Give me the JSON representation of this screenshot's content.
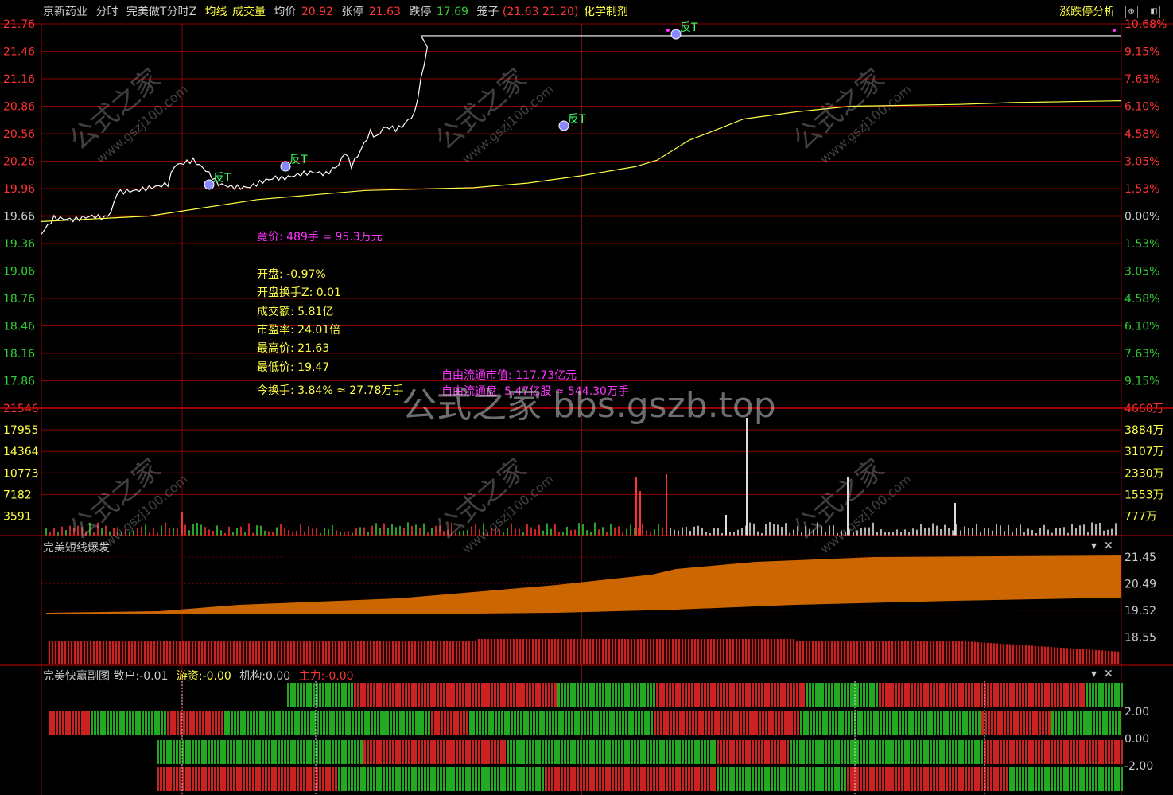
{
  "header": {
    "stock_name": "京新药业",
    "mode": "分时",
    "indicator": "完美做T分时Z",
    "avg_line_label": "均线",
    "volume_label": "成交量",
    "avg_price_label": "均价",
    "avg_price_value": "20.92",
    "limit_up_label": "张停",
    "limit_up_value": "21.63",
    "limit_down_label": "跌停",
    "limit_down_value": "17.69",
    "cage_label": "笼子",
    "cage_value": "(21.63 21.20)",
    "sector": "化学制剂",
    "analysis_link": "涨跌停分析",
    "colors": {
      "up": "#ff3333",
      "down": "#33cc33",
      "yellow": "#ffff44",
      "magenta": "#ff33ff",
      "orange": "#cc6600",
      "grid": "#aa0000"
    }
  },
  "price_axis": {
    "left_ticks": [
      "21.76",
      "21.46",
      "21.16",
      "20.86",
      "20.56",
      "20.26",
      "19.96",
      "19.66",
      "19.36",
      "19.06",
      "18.76",
      "18.46",
      "18.16",
      "17.86"
    ],
    "right_ticks": [
      "10.68%",
      "9.15%",
      "7.63%",
      "6.10%",
      "4.58%",
      "3.05%",
      "1.53%",
      "0.00%",
      "1.53%",
      "3.05%",
      "4.58%",
      "6.10%",
      "7.63%",
      "9.15%"
    ]
  },
  "volume_axis": {
    "left_ticks": [
      "21546",
      "17955",
      "14364",
      "10773",
      "7182",
      "3591"
    ],
    "right_ticks": [
      "4660万",
      "3884万",
      "3107万",
      "2330万",
      "1553万",
      "777万"
    ]
  },
  "sub1": {
    "title": "完美短线爆发",
    "right_ticks": [
      "21.45",
      "20.49",
      "19.52",
      "18.55"
    ]
  },
  "sub2": {
    "title": "完美快赢副图",
    "retail_label": "散户:",
    "retail_value": "-0.01",
    "hot_label": "游资:",
    "hot_value": "-0.00",
    "inst_label": "机构:",
    "inst_value": "0.00",
    "main_label": "主力:",
    "main_value": "-0.00",
    "right_ticks": [
      "2.00",
      "0.00",
      "-2.00"
    ]
  },
  "signals": [
    "反T",
    "反T",
    "反T",
    "反T"
  ],
  "info": {
    "auction": "竟价: 489手 = 95.3万元",
    "open_pct": "开盘: -0.97%",
    "open_turnover": "开盘换手Z: 0.01",
    "amount": "成交额: 5.81亿",
    "pe": "市盈率: 24.01倍",
    "high": "最高价: 21.63",
    "low": "最低价: 19.47",
    "turnover": "今换手: 3.84% ≈ 27.78万手",
    "free_cap": "自由流通市值: 117.73亿元",
    "free_float": "自由流通盘: 5.47亿股 ≈ 544.30万手"
  },
  "watermark": {
    "main": "公式之家 bbs.gszb.top",
    "diag": "公式之家",
    "diag_url": "www.gszj100.com"
  },
  "chart_data": [
    {
      "type": "line",
      "title": "",
      "ylim": [
        17.69,
        21.76
      ],
      "series": [
        {
          "name": "价格",
          "color": "#ffffff",
          "x_fraction": [
            0,
            0.02,
            0.05,
            0.08,
            0.1,
            0.11,
            0.12,
            0.15,
            0.18,
            0.2,
            0.21,
            0.24,
            0.26,
            0.28,
            0.3,
            0.32,
            0.33,
            0.35,
            0.37,
            0.38,
            0.4,
            0.41,
            0.43,
            0.45,
            0.47,
            0.48,
            0.49,
            0.5,
            0.51,
            0.52,
            0.53,
            0.54,
            0.55,
            0.56,
            0.57,
            0.58,
            0.59,
            0.6,
            0.61,
            0.6
          ],
          "values": [
            19.47,
            19.64,
            19.62,
            19.66,
            19.64,
            19.7,
            19.92,
            19.94,
            19.98,
            20.01,
            20.21,
            20.27,
            20.16,
            20.01,
            19.98,
            19.97,
            19.98,
            20.04,
            20.08,
            20.07,
            20.1,
            20.12,
            20.14,
            20.12,
            20.22,
            20.36,
            20.21,
            20.32,
            20.45,
            20.58,
            20.52,
            20.62,
            20.63,
            20.61,
            20.64,
            20.71,
            20.78,
            21.15,
            21.5,
            21.63
          ]
        },
        {
          "name": "均价",
          "color": "#ffff44",
          "x_fraction": [
            0,
            0.1,
            0.2,
            0.3,
            0.4,
            0.45,
            0.5,
            0.52,
            0.55,
            0.57,
            0.6,
            0.62,
            0.65,
            0.7,
            0.75,
            0.8,
            0.85,
            0.9,
            1.0
          ],
          "values": [
            19.6,
            19.66,
            19.84,
            19.94,
            19.97,
            20.02,
            20.1,
            20.14,
            20.2,
            20.27,
            20.49,
            20.58,
            20.72,
            20.8,
            20.86,
            20.87,
            20.88,
            20.9,
            20.92
          ]
        }
      ]
    }
  ]
}
